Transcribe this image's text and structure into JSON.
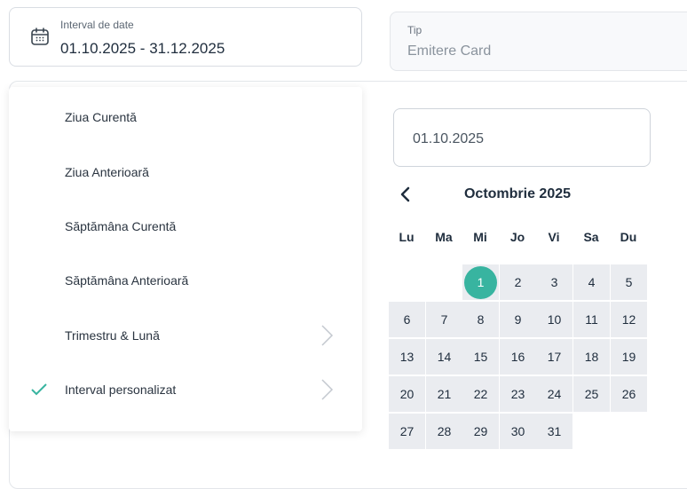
{
  "date_range": {
    "label": "Interval de date",
    "value": "01.10.2025 - 31.12.2025"
  },
  "type": {
    "label": "Tip",
    "value": "Emitere Card"
  },
  "options": [
    {
      "label": "Ziua Curentă",
      "has_submenu": false,
      "checked": false
    },
    {
      "label": "Ziua Anterioară",
      "has_submenu": false,
      "checked": false
    },
    {
      "label": "Săptămâna Curentă",
      "has_submenu": false,
      "checked": false
    },
    {
      "label": "Săptămâna Anterioară",
      "has_submenu": false,
      "checked": false
    },
    {
      "label": "Trimestru & Lună",
      "has_submenu": true,
      "checked": false
    },
    {
      "label": "Interval personalizat",
      "has_submenu": true,
      "checked": true
    }
  ],
  "calendar": {
    "input_value": "01.10.2025",
    "month_title": "Octombrie 2025",
    "weekdays": [
      "Lu",
      "Ma",
      "Mi",
      "Jo",
      "Vi",
      "Sa",
      "Du"
    ],
    "selected_day": "1",
    "weeks": [
      [
        "",
        "",
        "1",
        "2",
        "3",
        "4",
        "5"
      ],
      [
        "6",
        "7",
        "8",
        "9",
        "10",
        "11",
        "12"
      ],
      [
        "13",
        "14",
        "15",
        "16",
        "17",
        "18",
        "19"
      ],
      [
        "20",
        "21",
        "22",
        "23",
        "24",
        "25",
        "26"
      ],
      [
        "27",
        "28",
        "29",
        "30",
        "31",
        "",
        ""
      ]
    ]
  },
  "colors": {
    "accent": "#38b4a0",
    "cell_background": "#eaecf0"
  }
}
